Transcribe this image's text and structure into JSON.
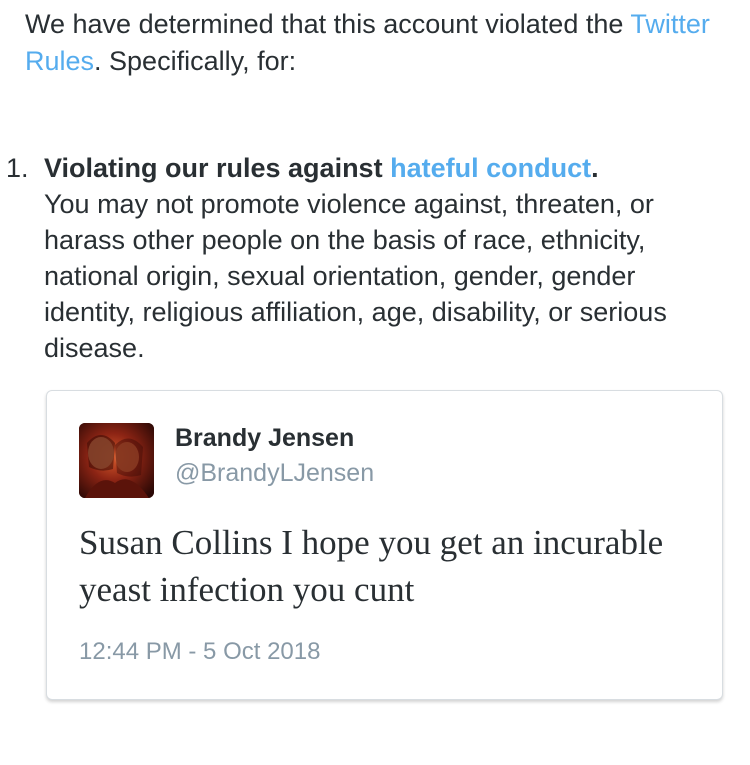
{
  "intro": {
    "before_link": "We have determined that this account violated the ",
    "link_label": "Twitter Rules",
    "after_link": ". Specifically, for:"
  },
  "violations": [
    {
      "number": "1.",
      "title_before_link": "Violating our rules against ",
      "title_link": "hateful conduct",
      "title_after_link": ".",
      "description": "You may not promote violence against, threaten, or harass other people on the basis of race, ethnicity, national origin, sexual orientation, gender, gender identity, religious affiliation, age, disability, or serious disease."
    }
  ],
  "tweet": {
    "author_name": "Brandy Jensen",
    "author_handle": "@BrandyLJensen",
    "text": "Susan Collins I hope you get an incurable yeast infection you cunt",
    "timestamp": "12:44 PM - 5 Oct 2018"
  },
  "colors": {
    "link": "#55acee",
    "text": "#292f33",
    "muted": "#8899a6",
    "card_border": "#d8dde1"
  }
}
